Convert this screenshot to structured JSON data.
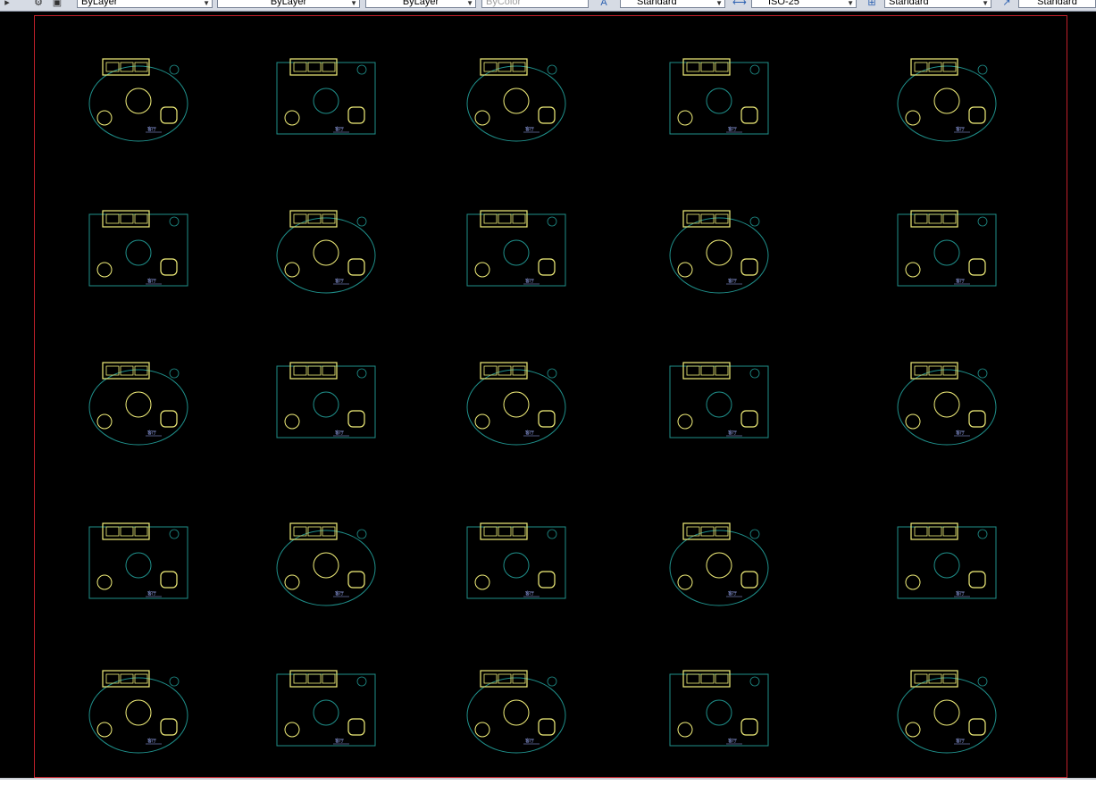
{
  "toolbar": {
    "layer_color": "ByLayer",
    "linetype": "ByLayer",
    "lineweight": "ByLayer",
    "plot_style": "ByColor",
    "text_style": "Standard",
    "dim_style": "ISO-25",
    "table_style": "Standard",
    "mleader_style": "Standard"
  },
  "colors": {
    "background": "#000000",
    "furniture": "#f2ef7a",
    "outline": "#1f8f8a",
    "border": "#c0202a",
    "label": "#9fb0ff"
  },
  "icons": [
    "layer-arrow-icon",
    "gear-icon",
    "layer-state-icon",
    "text-style-icon",
    "dim-style-icon",
    "table-style-icon",
    "mleader-style-icon"
  ],
  "blocks": [
    {
      "label": "客厅"
    },
    {
      "label": "客厅"
    },
    {
      "label": "客厅"
    },
    {
      "label": "客厅"
    },
    {
      "label": "客厅"
    },
    {
      "label": "客厅"
    },
    {
      "label": "客厅"
    },
    {
      "label": "客厅"
    },
    {
      "label": "客厅"
    },
    {
      "label": "客厅"
    },
    {
      "label": "客厅"
    },
    {
      "label": "客厅"
    },
    {
      "label": "客厅"
    },
    {
      "label": "客厅"
    },
    {
      "label": "客厅"
    },
    {
      "label": "客厅"
    },
    {
      "label": "客厅"
    },
    {
      "label": "客厅"
    },
    {
      "label": "客厅"
    },
    {
      "label": "客厅"
    },
    {
      "label": "客厅"
    },
    {
      "label": "客厅"
    },
    {
      "label": "客厅"
    },
    {
      "label": "客厅"
    },
    {
      "label": "客厅"
    }
  ]
}
